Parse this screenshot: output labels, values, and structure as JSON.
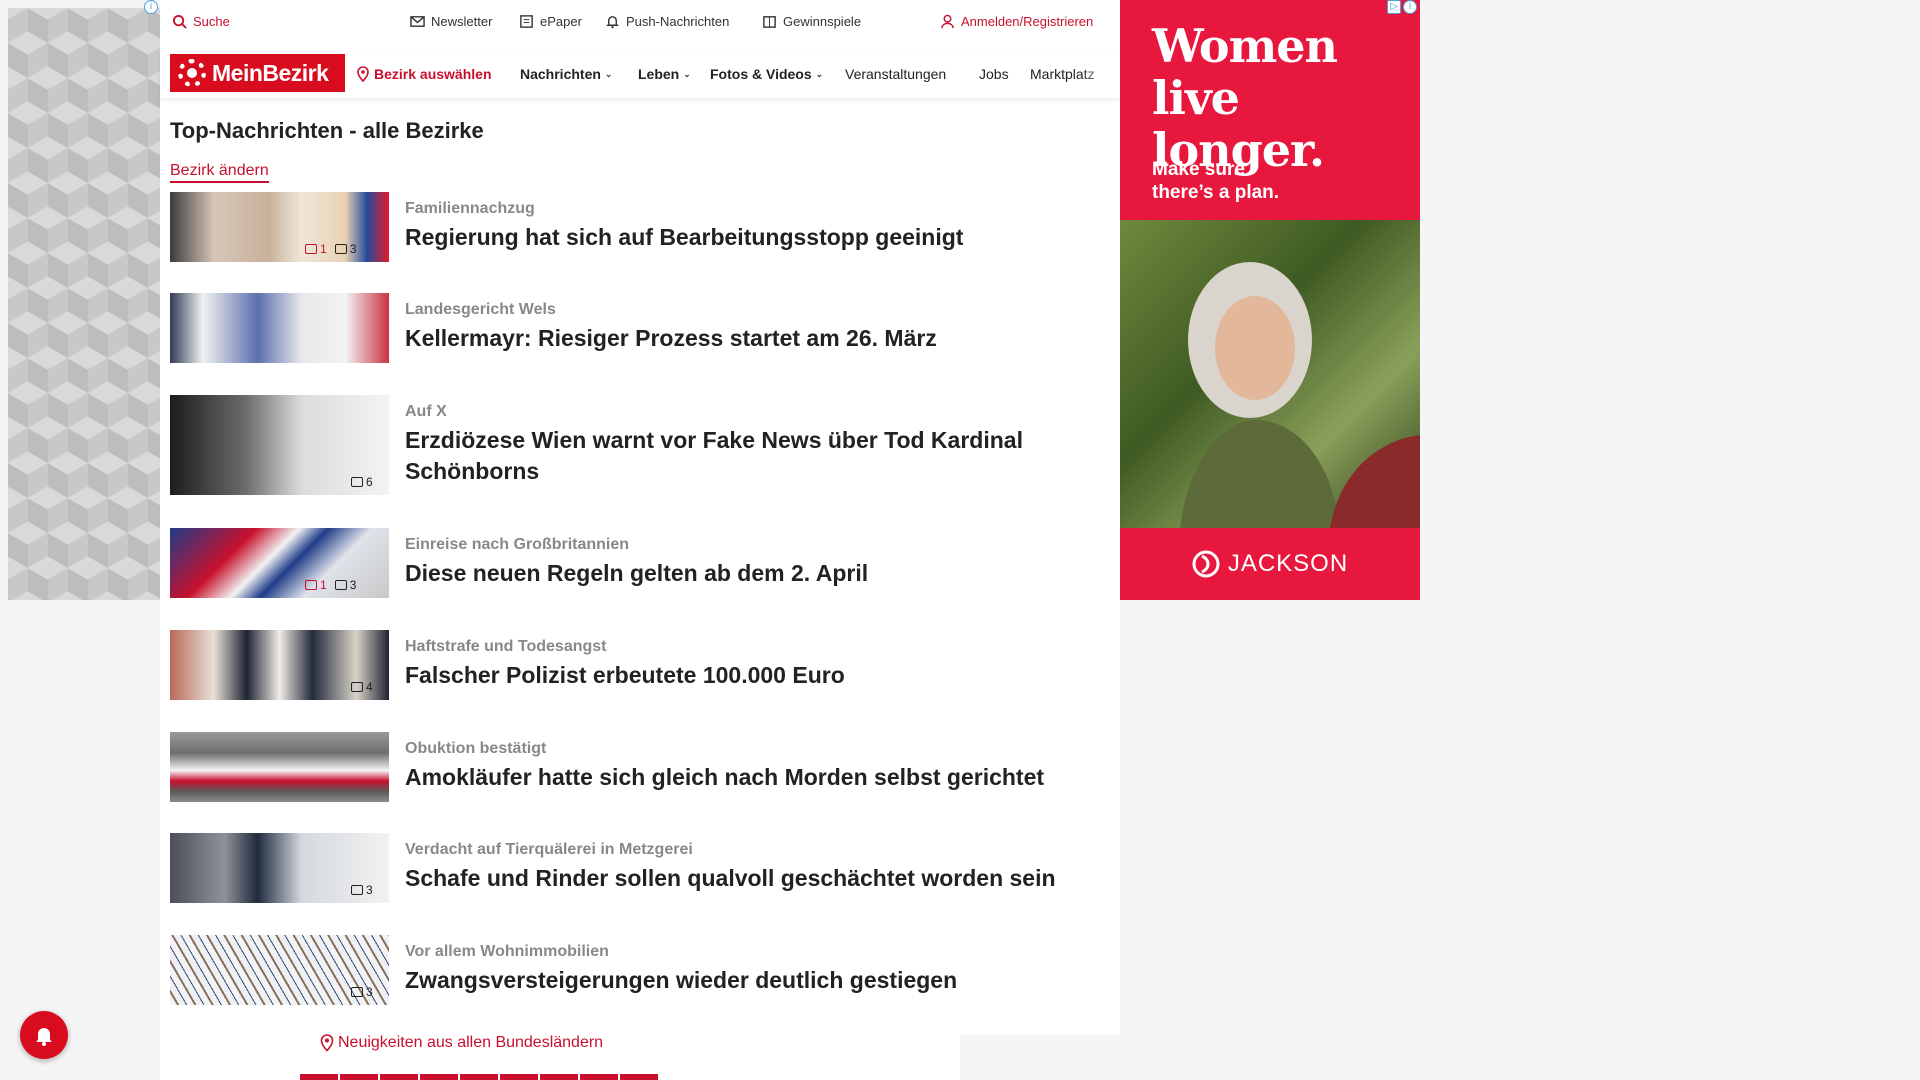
{
  "topbar": {
    "search": "Suche",
    "newsletter": "Newsletter",
    "epaper": "ePaper",
    "push": "Push-Nachrichten",
    "gewinnspiele": "Gewinnspiele",
    "login": "Anmelden/Registrieren"
  },
  "nav": {
    "logo": "MeinBezirk",
    "bezirk": "Bezirk auswählen",
    "items": [
      "Nachrichten",
      "Leben",
      "Fotos & Videos",
      "Veranstaltungen",
      "Jobs",
      "Marktplatz"
    ]
  },
  "page": {
    "title": "Top-Nachrichten - alle Bezirke",
    "change_link": "Bezirk ändern"
  },
  "articles": [
    {
      "kicker": "Familiennachzug",
      "headline": "Regierung hat sich auf Bearbeitungsstopp geeinigt",
      "comments": "1",
      "photos": "3"
    },
    {
      "kicker": "Landesgericht Wels",
      "headline": "Kellermayr: Riesiger Prozess startet am 26. März",
      "comments": "",
      "photos": ""
    },
    {
      "kicker": "Auf X",
      "headline": "Erzdiözese Wien warnt vor Fake News über Tod Kardinal Schönborns",
      "comments": "",
      "photos": "6"
    },
    {
      "kicker": "Einreise nach Großbritannien",
      "headline": "Diese neuen Regeln gelten ab dem 2. April",
      "comments": "1",
      "photos": "3"
    },
    {
      "kicker": "Haftstrafe und Todesangst",
      "headline": "Falscher Polizist erbeutete 100.000 Euro",
      "comments": "",
      "photos": "4"
    },
    {
      "kicker": "Obuktion bestätigt",
      "headline": "Amokläufer hatte sich gleich nach Morden selbst gerichtet",
      "comments": "",
      "photos": ""
    },
    {
      "kicker": "Verdacht auf Tierquälerei in Metzgerei",
      "headline": "Schafe und Rinder sollen qualvoll geschächtet worden sein",
      "comments": "",
      "photos": "3"
    },
    {
      "kicker": "Vor allem Wohnimmobilien",
      "headline": "Zwangsversteigerungen wieder deutlich gestiegen",
      "comments": "",
      "photos": "3"
    }
  ],
  "footer": {
    "link": "Neuigkeiten aus allen Bundesländern"
  },
  "ad": {
    "headline_1": "Women",
    "headline_2": "live longer.",
    "sub_1": "Make sure",
    "sub_2": "there’s a plan.",
    "brand": "JACKSON"
  },
  "colors": {
    "accent": "#c8102e",
    "ad_red": "#e8173d"
  }
}
